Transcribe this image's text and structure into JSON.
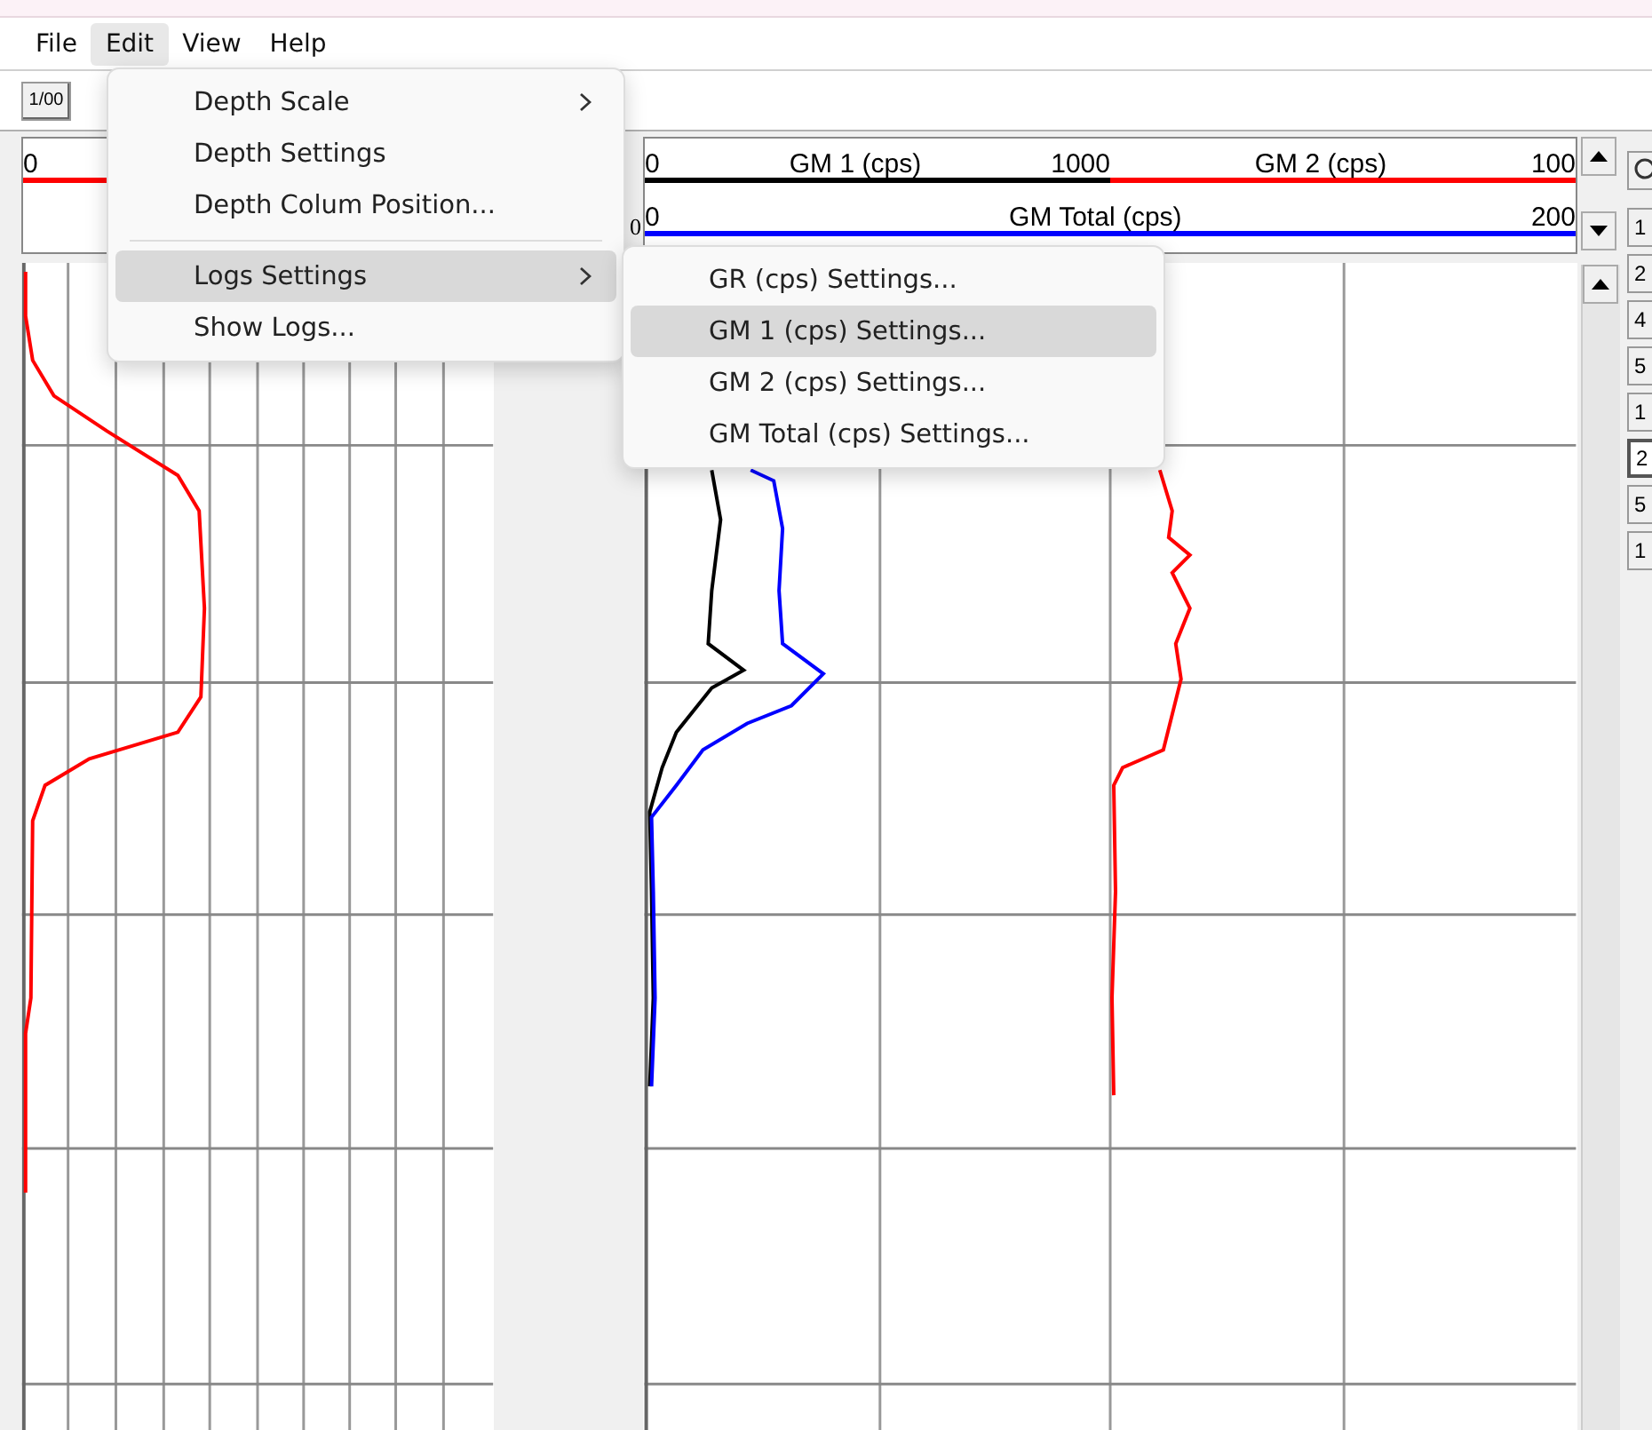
{
  "menu_bar": [
    {
      "label": "File",
      "selected": false
    },
    {
      "label": "Edit",
      "selected": true
    },
    {
      "label": "View",
      "selected": false
    },
    {
      "label": "Help",
      "selected": false
    }
  ],
  "toolbar": {
    "buttons": [
      "1/00"
    ]
  },
  "edit_menu": {
    "items": [
      {
        "kind": "item",
        "label": "Depth Scale",
        "submenu": true,
        "selected": false
      },
      {
        "kind": "item",
        "label": "Depth Settings",
        "submenu": false,
        "selected": false
      },
      {
        "kind": "item",
        "label": "Depth Colum Position...",
        "submenu": false,
        "selected": false
      },
      {
        "kind": "separator"
      },
      {
        "kind": "item",
        "label": "Logs Settings",
        "submenu": true,
        "selected": true
      },
      {
        "kind": "item",
        "label": "Show Logs...",
        "submenu": false,
        "selected": false
      }
    ]
  },
  "logs_submenu": {
    "items": [
      {
        "label": "GR (cps) Settings...",
        "selected": false
      },
      {
        "label": "GM 1 (cps) Settings...",
        "selected": true
      },
      {
        "label": "GM 2 (cps) Settings...",
        "selected": false
      },
      {
        "label": "GM Total (cps) Settings...",
        "selected": false
      }
    ]
  },
  "left_track": {
    "scales": [
      {
        "min": "0",
        "color": "#ff0000"
      }
    ]
  },
  "depth_marker": "0",
  "right_track": {
    "header_rows": [
      {
        "scales": [
          {
            "min": "0",
            "name": "GM 1 (cps)",
            "max": "1000",
            "color": "#000000"
          },
          {
            "name": "GM 2 (cps)",
            "max": "100",
            "color": "#ff0000"
          }
        ]
      },
      {
        "scales": [
          {
            "min": "0",
            "name": "GM Total (cps)",
            "max": "200",
            "color": "#0000ff"
          }
        ]
      }
    ]
  },
  "scale_panel": {
    "buttons": [
      {
        "label": "1",
        "selected": false
      },
      {
        "label": "2",
        "selected": false
      },
      {
        "label": "4",
        "selected": false
      },
      {
        "label": "5",
        "selected": false
      },
      {
        "label": "1",
        "selected": false
      },
      {
        "label": "2",
        "selected": true
      },
      {
        "label": "5",
        "selected": false
      },
      {
        "label": "1",
        "selected": false
      }
    ]
  }
}
